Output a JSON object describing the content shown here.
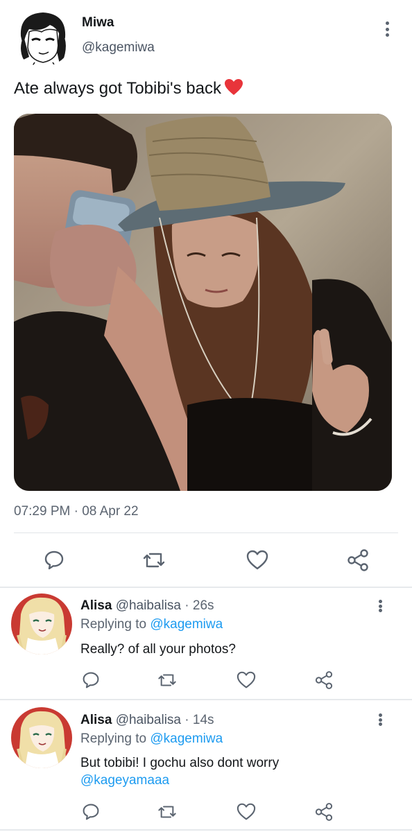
{
  "main_tweet": {
    "author_name": "Miwa",
    "author_handle": "@kagemiwa",
    "text": "Ate always got Tobibi's back",
    "emoji": "red-heart",
    "timestamp": "07:29 PM · 08 Apr 22",
    "actions": [
      "comment-icon",
      "retweet-icon",
      "like-icon",
      "share-icon"
    ]
  },
  "replies": [
    {
      "author_name": "Alisa",
      "author_handle": "@haibalisa",
      "time": "· 26s",
      "replying_label": "Replying to",
      "replying_to": "@kagemiwa",
      "text": "Really? of all your photos?",
      "mention_line": ""
    },
    {
      "author_name": "Alisa",
      "author_handle": "@haibalisa",
      "time": "· 14s",
      "replying_label": "Replying to",
      "replying_to": "@kagemiwa",
      "text": "But tobibi! I gochu also dont worry",
      "mention_line": "@kageyamaaa"
    }
  ],
  "colors": {
    "link": "#1d9bf0",
    "secondary_text": "#5b6470",
    "icon": "#5b6470",
    "heart": "#e0245e"
  }
}
